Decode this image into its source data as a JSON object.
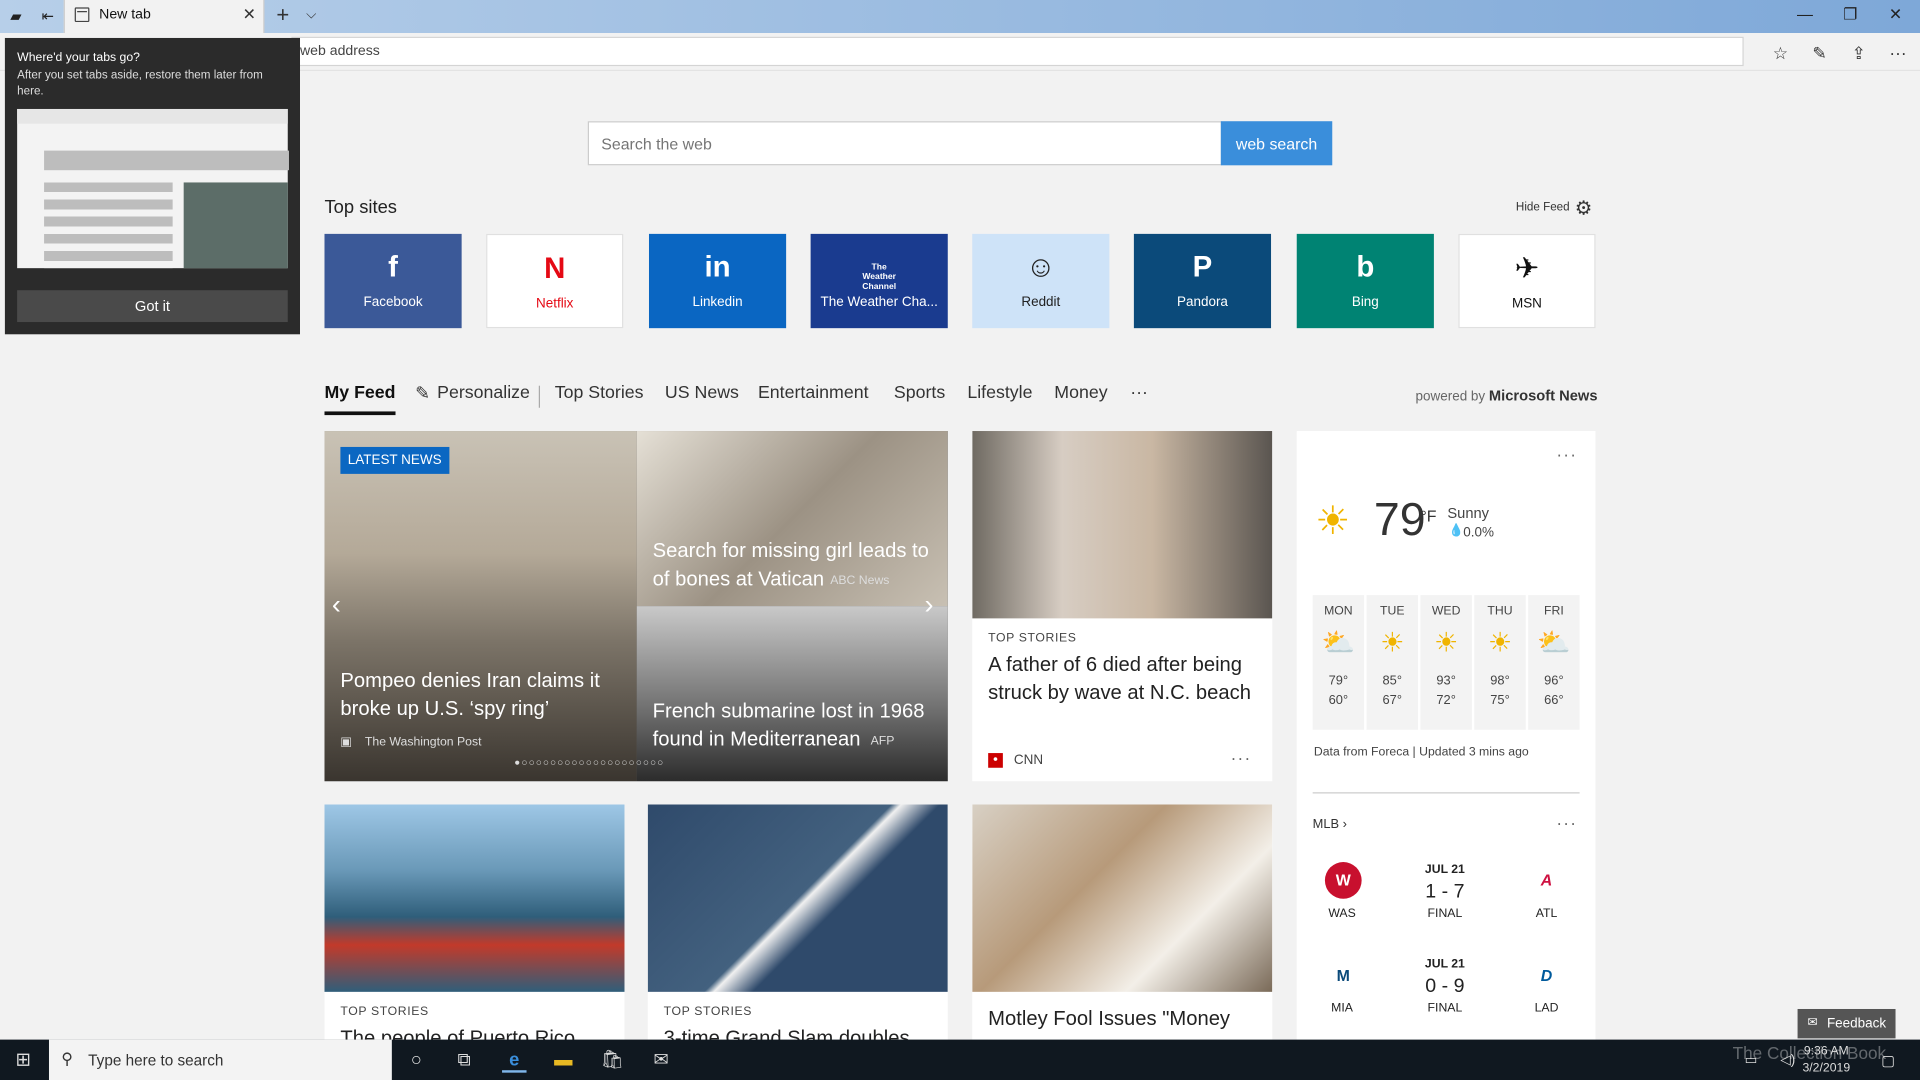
{
  "tab": {
    "label": "New tab"
  },
  "address": {
    "placeholder": "web address"
  },
  "search": {
    "placeholder": "Search the web",
    "button": "web search"
  },
  "top_sites": {
    "title": "Top sites",
    "hide_feed": "Hide Feed",
    "tiles": [
      {
        "name": "Facebook",
        "glyph": "f",
        "color": "#3b5998",
        "text": "#ffffff"
      },
      {
        "name": "Netflix",
        "glyph": "N",
        "color": "#ffffff",
        "text": "#e50914"
      },
      {
        "name": "Linkedin",
        "glyph": "in",
        "color": "#0a66c2",
        "text": "#ffffff"
      },
      {
        "name": "The Weather Cha...",
        "glyph": "The Weather Channel",
        "color": "#1a3b8f",
        "text": "#ffffff"
      },
      {
        "name": "Reddit",
        "glyph": "☺",
        "color": "#cee3f8",
        "text": "#222222"
      },
      {
        "name": "Pandora",
        "glyph": "P",
        "color": "#0b4a7a",
        "text": "#ffffff"
      },
      {
        "name": "Bing",
        "glyph": "b",
        "color": "#008373",
        "text": "#ffffff"
      },
      {
        "name": "MSN",
        "glyph": "✈",
        "color": "#ffffff",
        "text": "#111111"
      }
    ]
  },
  "feed_tabs": {
    "my_feed": "My Feed",
    "personalize": "Personalize",
    "items": [
      "Top Stories",
      "US News",
      "Entertainment",
      "Sports",
      "Lifestyle",
      "Money"
    ],
    "more": "···",
    "powered_prefix": "powered by",
    "powered_brand": "Microsoft News"
  },
  "hero": {
    "badge": "LATEST NEWS",
    "main_title": "Pompeo denies Iran claims it broke up U.S. ‘spy ring’",
    "main_source": "The Washington Post",
    "top_title": "Search for missing girl leads to of bones at Vatican",
    "top_source": "ABC News",
    "bottom_title": "French submarine lost in 1968 found in Mediterranean",
    "bottom_source": "AFP"
  },
  "story1": {
    "category": "TOP STORIES",
    "title": "A father of 6 died after being struck by wave at N.C. beach",
    "source": "CNN"
  },
  "story2": {
    "category": "TOP STORIES",
    "title": "The people of Puerto Rico"
  },
  "story3": {
    "category": "TOP STORIES",
    "title": "3-time Grand Slam doubles"
  },
  "story4": {
    "title": "Motley Fool Issues \"Money"
  },
  "weather": {
    "temp": "79",
    "unit": "°F",
    "condition": "Sunny",
    "precip": "0.0%",
    "forecast": [
      {
        "day": "MON",
        "hi": "79°",
        "lo": "60°",
        "icon": "partly-cloudy-icon"
      },
      {
        "day": "TUE",
        "hi": "85°",
        "lo": "67°",
        "icon": "sunny-icon"
      },
      {
        "day": "WED",
        "hi": "93°",
        "lo": "72°",
        "icon": "sunny-icon"
      },
      {
        "day": "THU",
        "hi": "98°",
        "lo": "75°",
        "icon": "sunny-icon"
      },
      {
        "day": "FRI",
        "hi": "96°",
        "lo": "66°",
        "icon": "partly-cloudy-icon"
      }
    ],
    "footer": "Data from Foreca | Updated 3 mins ago"
  },
  "mlb": {
    "title": "MLB",
    "games": [
      {
        "date": "JUL 21",
        "score": "1 - 7",
        "status": "FINAL",
        "home": "WAS",
        "away": "ATL"
      },
      {
        "date": "JUL 21",
        "score": "0 - 9",
        "status": "FINAL",
        "home": "MIA",
        "away": "LAD"
      }
    ]
  },
  "feedback": "Feedback",
  "popup": {
    "heading": "Where'd your tabs go?",
    "body": "After you set tabs aside, restore them later from here.",
    "button": "Got it"
  },
  "taskbar": {
    "search_placeholder": "Type here to search",
    "time": "9:36 AM",
    "date": "3/2/2019",
    "watermark": "The Collection Book"
  }
}
